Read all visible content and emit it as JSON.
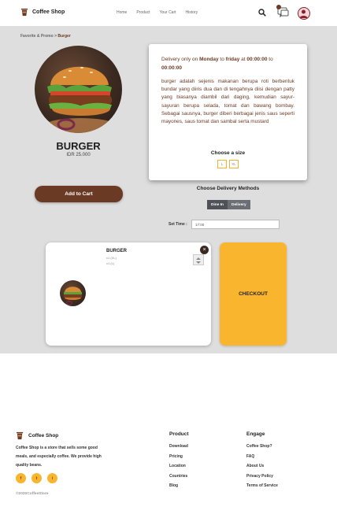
{
  "header": {
    "brand": "Coffee Shop",
    "nav": [
      "Home",
      "Product",
      "Your Cart",
      "History"
    ]
  },
  "breadcrumb": {
    "parent": "Favorite & Promo",
    "separator": " > ",
    "current": "Burger"
  },
  "product": {
    "name": "BURGER",
    "price": "IDR 25.000",
    "add_to_cart": "Add to Cart"
  },
  "details": {
    "delivery_prefix": "Delivery only on ",
    "day_start": "Monday",
    "to1": " to ",
    "day_end": "friday",
    "at": " at ",
    "time_start": "00:00:00",
    "to2": " to ",
    "time_end": "00:00:00",
    "description": "burger adalah sejenis makanan berupa roti berbentuk bundar yang diiris dua dan di tengahnya diisi dengan patty yang biasanya diambil dari daging, kemudian sayur-sayuran berupa selada, tomat dan bawang bombay. Sebagai sausnya, burger diberi berbagai jenis saus seperti mayones, saus tomat dan sambal serta mustard",
    "size_title": "Choose a size",
    "sizes": [
      "L",
      "XL"
    ]
  },
  "delivery": {
    "title": "Choose Delivery Methods",
    "options": [
      "Dine In",
      "Delivery"
    ],
    "time_label": "Set Time :",
    "time_value": "17:00"
  },
  "cart": {
    "item_name": "BURGER",
    "options": [
      "x1 (XL)",
      "x1 (L)"
    ],
    "remove_icon": "close-icon",
    "checkout": "CHECKOUT"
  },
  "footer": {
    "brand": "Coffee Shop",
    "description": "Coffee Shop is a store that sells some good meals, and especially coffee. We provide high quality beans.",
    "copyright": "©2020CoffeeStore",
    "product_title": "Product",
    "product_links": [
      "Download",
      "Pricing",
      "Location",
      "Countries",
      "Blog"
    ],
    "engage_title": "Engage",
    "engage_links": [
      "Coffee Shop?",
      "FAQ",
      "About Us",
      "Privacy Policy",
      "Terms of Service"
    ],
    "social": [
      "f",
      "t",
      "i"
    ]
  },
  "colors": {
    "brand_brown": "#6b3a24",
    "accent_yellow": "#f9b52e",
    "panel_gray": "#dedede"
  }
}
